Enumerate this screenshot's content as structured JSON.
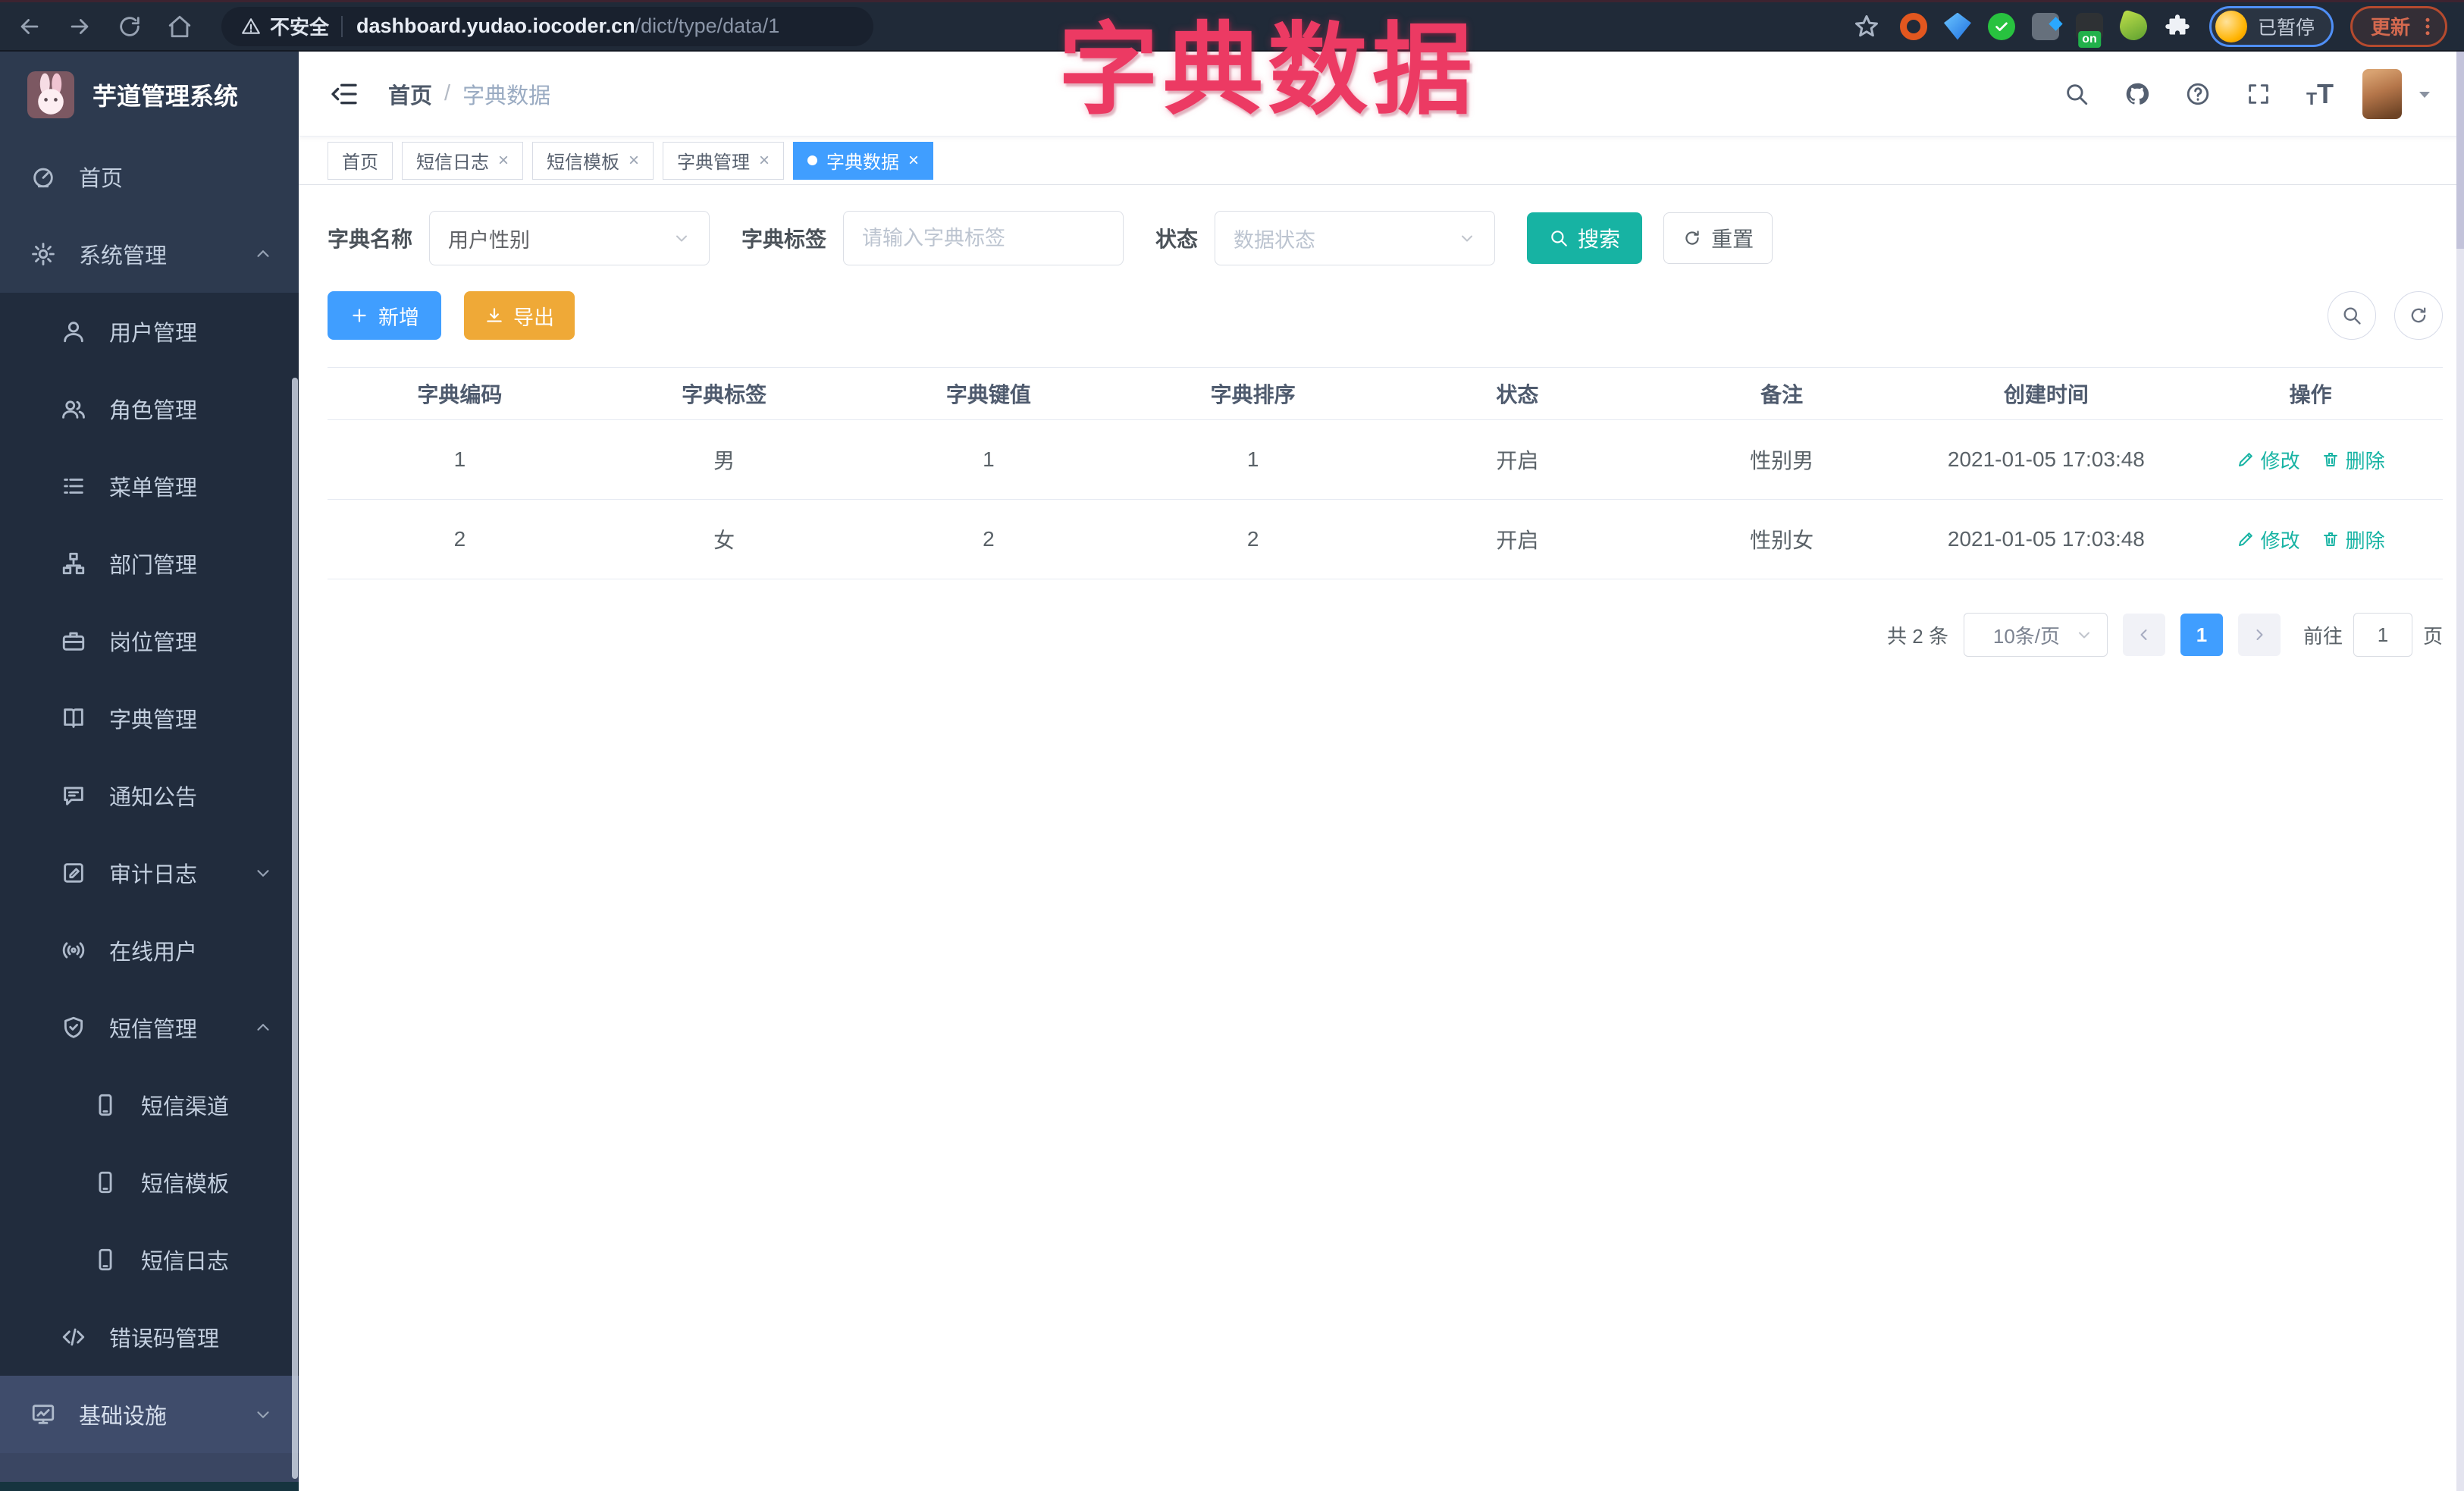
{
  "browser": {
    "security_label": "不安全",
    "url_host": "dashboard.yudao.iocoder.cn",
    "url_path": "/dict/type/data/1",
    "profile_status": "已暂停",
    "update_label": "更新",
    "extensions": [
      {
        "name": "orange-ring"
      },
      {
        "name": "blue-gem"
      },
      {
        "name": "green-check"
      },
      {
        "name": "gray-tool"
      },
      {
        "name": "dark-on",
        "badge": "on"
      },
      {
        "name": "green-leaf"
      },
      {
        "name": "puzzle"
      }
    ]
  },
  "annotation": {
    "text": "字典数据"
  },
  "sidebar": {
    "logo_title": "芋道管理系统",
    "menu": [
      {
        "name": "home",
        "label": "首页",
        "icon": "dashboard-icon",
        "level": 1
      },
      {
        "name": "system-management",
        "label": "系统管理",
        "icon": "gear-icon",
        "level": 1,
        "caret": "up"
      },
      {
        "name": "user-management",
        "label": "用户管理",
        "icon": "user-icon",
        "level": 2
      },
      {
        "name": "role-management",
        "label": "角色管理",
        "icon": "users-icon",
        "level": 2
      },
      {
        "name": "menu-management",
        "label": "菜单管理",
        "icon": "list-icon",
        "level": 2
      },
      {
        "name": "dept-management",
        "label": "部门管理",
        "icon": "org-tree-icon",
        "level": 2
      },
      {
        "name": "post-management",
        "label": "岗位管理",
        "icon": "briefcase-icon",
        "level": 2
      },
      {
        "name": "dict-management",
        "label": "字典管理",
        "icon": "book-icon",
        "level": 2
      },
      {
        "name": "notice-announcement",
        "label": "通知公告",
        "icon": "announcement-icon",
        "level": 2
      },
      {
        "name": "audit-log",
        "label": "审计日志",
        "icon": "log-icon",
        "level": 2,
        "caret": "down"
      },
      {
        "name": "online-users",
        "label": "在线用户",
        "icon": "broadcast-icon",
        "level": 2
      },
      {
        "name": "sms-management",
        "label": "短信管理",
        "icon": "shield-icon",
        "level": 2,
        "caret": "up"
      },
      {
        "name": "sms-channel",
        "label": "短信渠道",
        "icon": "phone-icon",
        "level": 3
      },
      {
        "name": "sms-template",
        "label": "短信模板",
        "icon": "phone-icon",
        "level": 3
      },
      {
        "name": "sms-log",
        "label": "短信日志",
        "icon": "phone-icon",
        "level": 3
      },
      {
        "name": "error-code-management",
        "label": "错误码管理",
        "icon": "code-icon",
        "level": 2
      },
      {
        "name": "infrastructure",
        "label": "基础设施",
        "icon": "monitor-icon",
        "level": 1,
        "caret": "down",
        "highlight": true
      }
    ]
  },
  "header": {
    "breadcrumb": {
      "home": "首页",
      "separator": "/",
      "current": "字典数据"
    }
  },
  "tabs": [
    {
      "name": "home",
      "label": "首页"
    },
    {
      "name": "sms-log",
      "label": "短信日志",
      "closable": true
    },
    {
      "name": "sms-template",
      "label": "短信模板",
      "closable": true
    },
    {
      "name": "dict-management",
      "label": "字典管理",
      "closable": true
    },
    {
      "name": "dict-data",
      "label": "字典数据",
      "closable": true,
      "active": true
    }
  ],
  "filters": {
    "dict_name_label": "字典名称",
    "dict_name_value": "用户性别",
    "dict_label_label": "字典标签",
    "dict_label_placeholder": "请输入字典标签",
    "status_label": "状态",
    "status_placeholder": "数据状态",
    "search_label": "搜索",
    "reset_label": "重置"
  },
  "toolbar": {
    "add_label": "新增",
    "export_label": "导出"
  },
  "table": {
    "columns": [
      "字典编码",
      "字典标签",
      "字典键值",
      "字典排序",
      "状态",
      "备注",
      "创建时间",
      "操作"
    ],
    "rows": [
      {
        "code": "1",
        "label": "男",
        "value": "1",
        "sort": "1",
        "status": "开启",
        "remark": "性别男",
        "created_at": "2021-01-05 17:03:48"
      },
      {
        "code": "2",
        "label": "女",
        "value": "2",
        "sort": "2",
        "status": "开启",
        "remark": "性别女",
        "created_at": "2021-01-05 17:03:48"
      }
    ],
    "edit_label": "修改",
    "delete_label": "删除"
  },
  "pagination": {
    "total_text": "共 2 条",
    "page_size": "10条/页",
    "current_page": "1",
    "goto_label": "前往",
    "goto_value": "1",
    "page_label": "页"
  },
  "ui": {
    "close_glyph": "×",
    "font_icon_small": "T",
    "font_icon_large": "T"
  },
  "colors": {
    "accent_teal": "#17b3a3",
    "accent_blue": "#409eff",
    "warning_orange": "#efa937",
    "annotation_pink": "#ec3a63",
    "sidebar_bg": "#2d3a4f",
    "submenu_bg": "#212c3d",
    "browser_bar_bg": "#202a38"
  }
}
